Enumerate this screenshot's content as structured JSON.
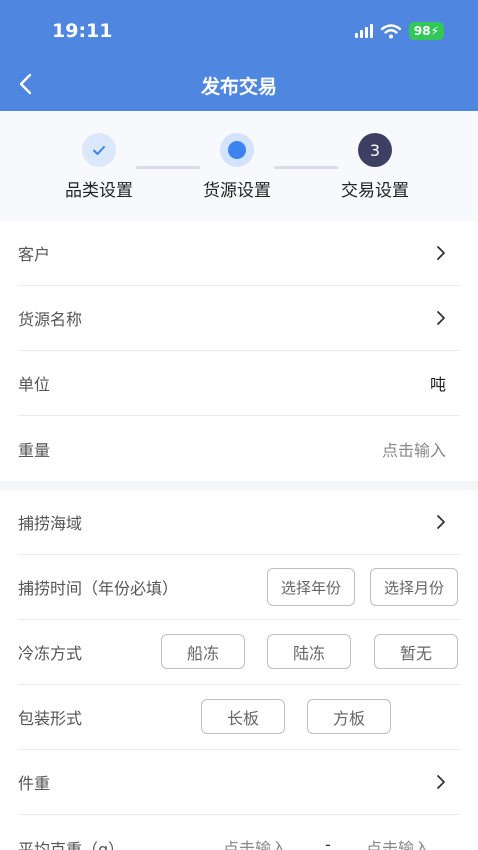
{
  "status": {
    "time": "19:11",
    "battery": "98"
  },
  "nav": {
    "title": "发布交易"
  },
  "steps": [
    {
      "label": "品类设置",
      "state": "done"
    },
    {
      "label": "货源设置",
      "state": "current"
    },
    {
      "label": "交易设置",
      "state": "next",
      "number": "3"
    }
  ],
  "section1": {
    "customer": {
      "label": "客户"
    },
    "source_name": {
      "label": "货源名称"
    },
    "unit": {
      "label": "单位",
      "value": "吨"
    },
    "weight": {
      "label": "重量",
      "placeholder": "点击输入"
    }
  },
  "section2": {
    "sea_area": {
      "label": "捕捞海域"
    },
    "fishing_time": {
      "label": "捕捞时间（年份必填）",
      "year_button": "选择年份",
      "month_button": "选择月份"
    },
    "freeze": {
      "label": "冷冻方式",
      "options": [
        "船冻",
        "陆冻",
        "暂无"
      ]
    },
    "packaging": {
      "label": "包装形式",
      "options": [
        "长板",
        "方板"
      ]
    },
    "piece_weight": {
      "label": "件重"
    },
    "avg_weight": {
      "label": "平均克重（g）",
      "min_placeholder": "点击输入",
      "separator": "-",
      "max_placeholder": "点击输入"
    }
  },
  "colors": {
    "primary": "#4f86e0",
    "step_active": "#3e82ef",
    "step_next": "#3d3f63"
  }
}
